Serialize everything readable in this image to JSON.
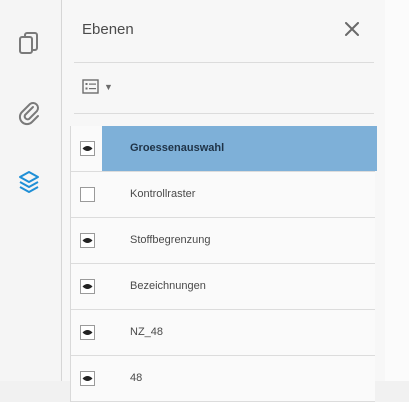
{
  "rail": {
    "items": [
      {
        "name": "pages-icon"
      },
      {
        "name": "attachments-icon"
      },
      {
        "name": "layers-icon",
        "active": true
      }
    ]
  },
  "panel": {
    "title": "Ebenen",
    "close_icon": "close-icon",
    "options_icon": "layer-options-icon"
  },
  "layers": [
    {
      "label": "Groessenauswahl",
      "visible": true,
      "selected": true
    },
    {
      "label": "Kontrollraster",
      "visible": false,
      "selected": false
    },
    {
      "label": "Stoffbegrenzung",
      "visible": true,
      "selected": false
    },
    {
      "label": "Bezeichnungen",
      "visible": true,
      "selected": false
    },
    {
      "label": "NZ_48",
      "visible": true,
      "selected": false
    },
    {
      "label": "48",
      "visible": true,
      "selected": false
    }
  ],
  "colors": {
    "accent": "#7eb0d8",
    "active_icon": "#1f8fd6"
  }
}
